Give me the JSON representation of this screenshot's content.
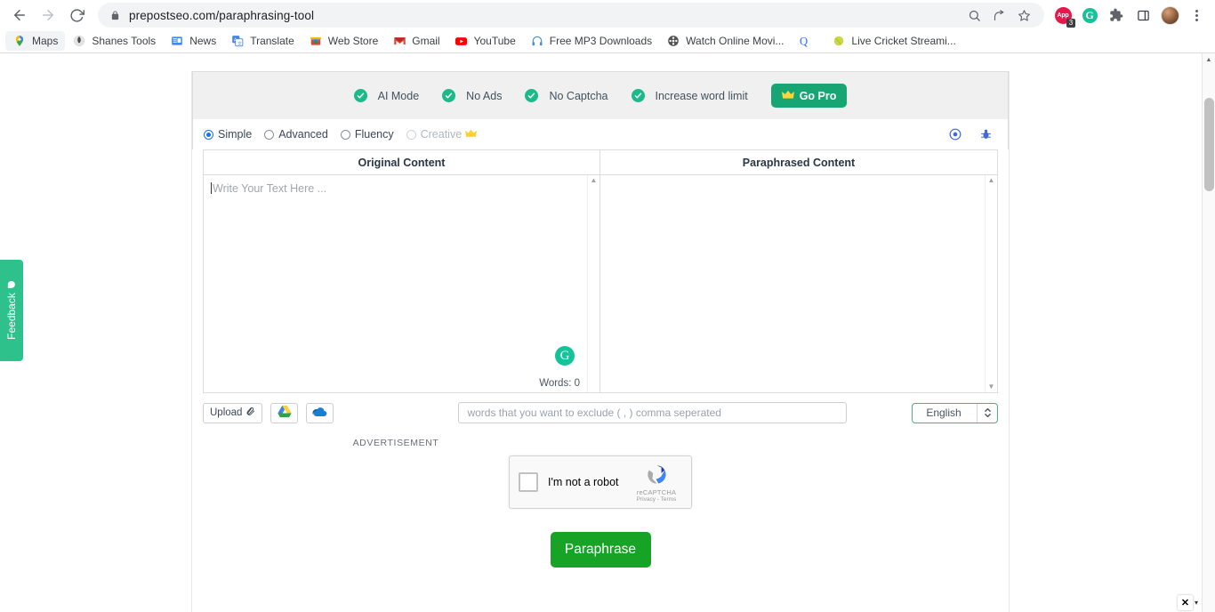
{
  "browser": {
    "back_icon": "back-arrow-icon",
    "forward_icon": "forward-arrow-icon",
    "reload_icon": "reload-icon",
    "url": "prepostseo.com/paraphrasing-tool",
    "lock_icon": "lock-icon",
    "omnibox_icons": [
      "zoom-search-icon",
      "share-icon",
      "bookmark-star-icon"
    ],
    "extensions": [
      {
        "name": "app-extension",
        "label": "App",
        "badge": "3"
      },
      {
        "name": "grammarly-extension",
        "label": "G"
      },
      {
        "name": "puzzle-extensions-icon"
      },
      {
        "name": "sidepanel-icon"
      },
      {
        "name": "profile-avatar"
      },
      {
        "name": "chrome-menu-icon"
      }
    ],
    "bookmarks": [
      {
        "label": "Maps",
        "icon": "maps-pin-icon",
        "active": true
      },
      {
        "label": "Shanes Tools",
        "icon": "globe-icon",
        "active": false
      },
      {
        "label": "News",
        "icon": "google-news-icon",
        "active": false
      },
      {
        "label": "Translate",
        "icon": "google-translate-icon",
        "active": false
      },
      {
        "label": "Web Store",
        "icon": "chrome-web-store-icon",
        "active": false
      },
      {
        "label": "Gmail",
        "icon": "gmail-icon",
        "active": false
      },
      {
        "label": "YouTube",
        "icon": "youtube-icon",
        "active": false
      },
      {
        "label": "Free MP3 Downloads",
        "icon": "headphones-icon",
        "active": false
      },
      {
        "label": "Watch Online Movi...",
        "icon": "film-reel-icon",
        "active": false
      },
      {
        "label": "",
        "icon": "quora-icon",
        "active": false
      },
      {
        "label": "Live Cricket Streami...",
        "icon": "cricket-ball-icon",
        "active": false
      }
    ]
  },
  "feature_bar": {
    "features": [
      {
        "label": "AI Mode"
      },
      {
        "label": "No Ads"
      },
      {
        "label": "No Captcha"
      },
      {
        "label": "Increase word limit"
      }
    ],
    "go_pro_label": "Go Pro",
    "crown_icon": "crown-icon"
  },
  "modes": {
    "options": [
      {
        "label": "Simple",
        "selected": true,
        "disabled": false,
        "premium": false
      },
      {
        "label": "Advanced",
        "selected": false,
        "disabled": false,
        "premium": false
      },
      {
        "label": "Fluency",
        "selected": false,
        "disabled": false,
        "premium": false
      },
      {
        "label": "Creative",
        "selected": false,
        "disabled": true,
        "premium": true
      }
    ],
    "right_icons": [
      {
        "name": "settings-circle-icon"
      },
      {
        "name": "report-bug-icon"
      }
    ]
  },
  "panels": {
    "original": {
      "title": "Original Content",
      "placeholder": "Write Your Text Here ...",
      "value": "",
      "word_count_label": "Words: 0",
      "grammarly_icon": "grammarly-icon"
    },
    "paraphrased": {
      "title": "Paraphrased Content",
      "value": ""
    }
  },
  "tools": {
    "upload_label": "Upload",
    "upload_icon": "paperclip-icon",
    "google_drive_icon": "google-drive-icon",
    "onedrive_icon": "onedrive-cloud-icon",
    "exclude_placeholder": "words that you want to exclude ( , ) comma seperated",
    "exclude_value": "",
    "language_selected": "English",
    "language_options": [
      "English"
    ]
  },
  "advertisement_label": "ADVERTISEMENT",
  "recaptcha": {
    "checkbox_label": "I'm not a robot",
    "checked": false,
    "brand": "reCAPTCHA",
    "terms": "Privacy - Terms",
    "logo_icon": "recaptcha-logo-icon"
  },
  "submit": {
    "label": "Paraphrase",
    "color": "#16a326"
  },
  "feedback_tab": {
    "label": "Feedback",
    "color": "#2fc18c"
  },
  "ad_close": {
    "close_label": "✕",
    "caret_label": "▾"
  },
  "colors": {
    "accent_green": "#17a673",
    "submit_green": "#16a326",
    "check_green": "#1cb98a",
    "radio_blue": "#1a73e8"
  }
}
